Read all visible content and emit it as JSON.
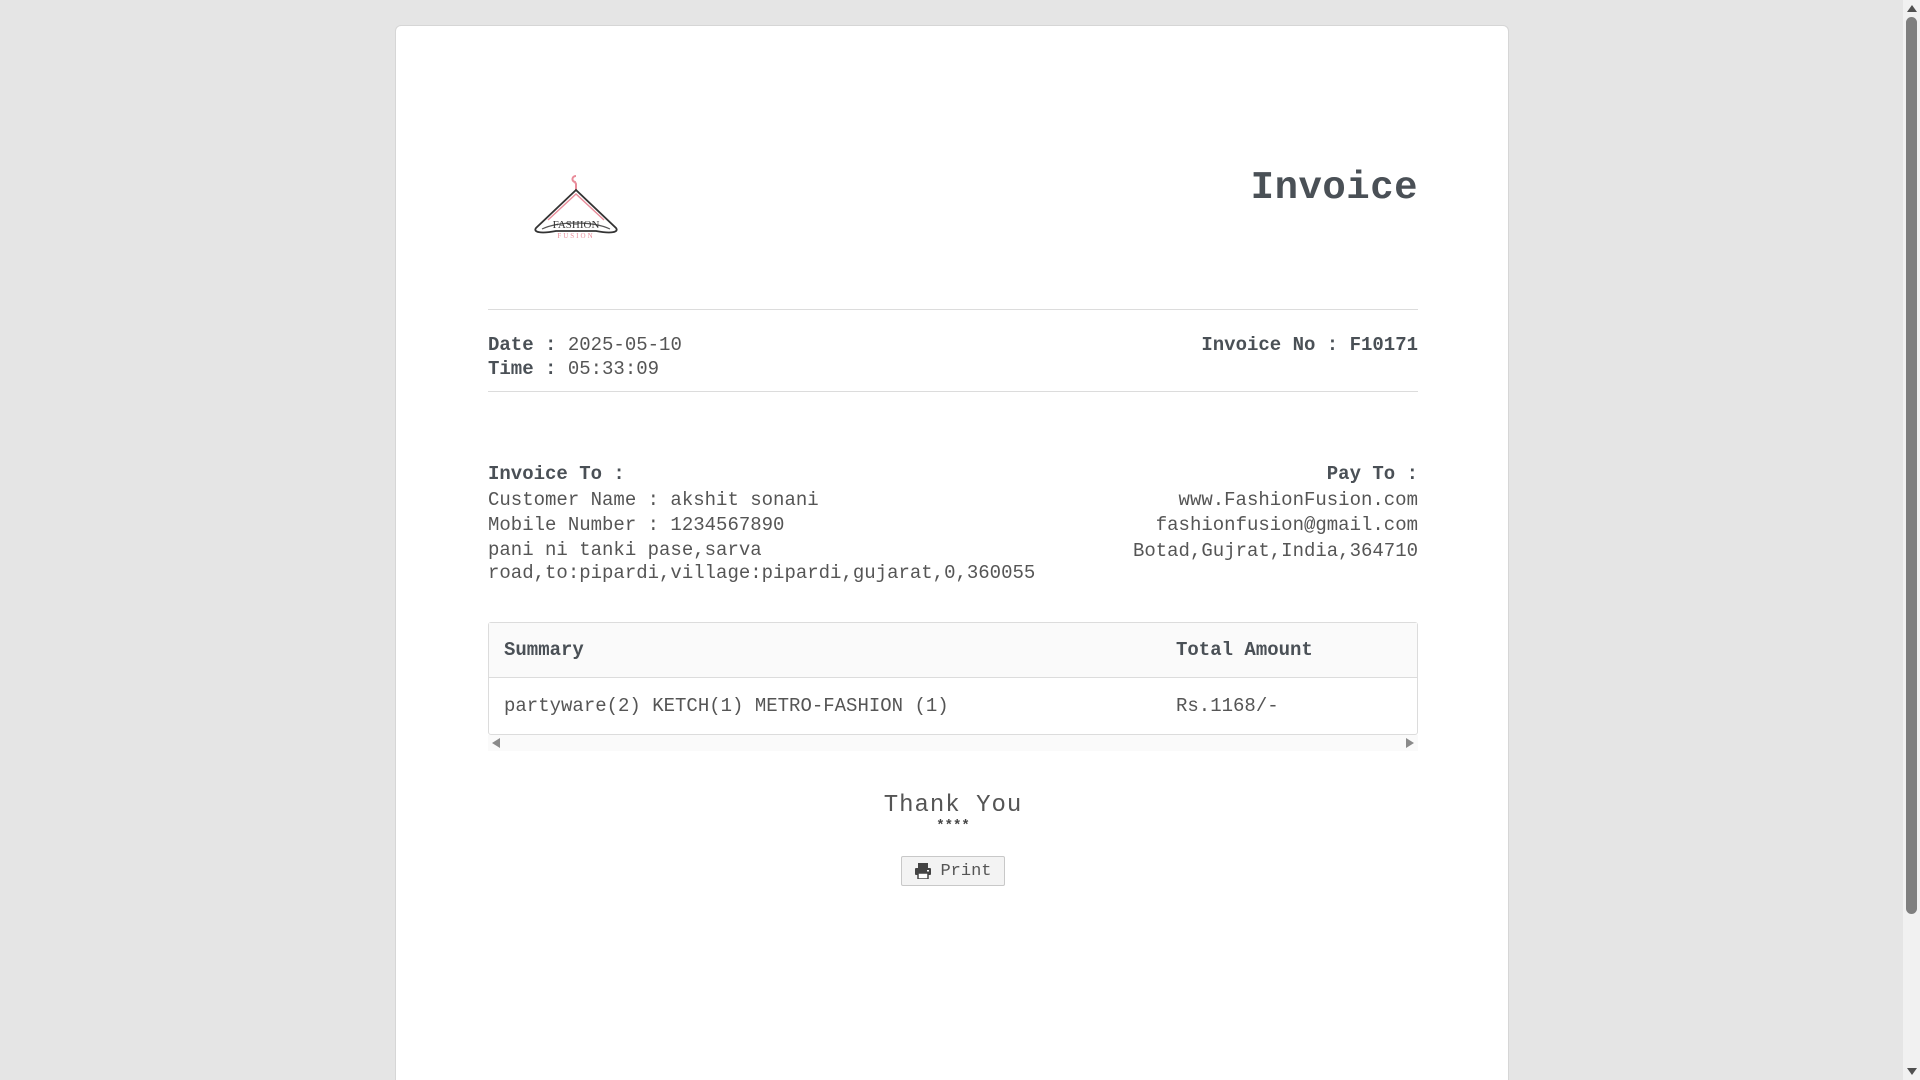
{
  "header": {
    "logo_name": "hanger-logo",
    "logo_text_top": "FASHION",
    "logo_text_bottom": "FUSION",
    "title": "Invoice"
  },
  "meta": {
    "date_label": "Date :",
    "date_value": "2025-05-10",
    "time_label": "Time :",
    "time_value": "05:33:09",
    "invoice_no": "Invoice No : F10171"
  },
  "bill_to": {
    "title": "Invoice To :",
    "customer_line": "Customer Name : akshit sonani",
    "mobile_line": "Mobile Number : 1234567890",
    "address": "pani ni tanki pase,sarva road,to:pipardi,village:pipardi,gujarat,0,360055"
  },
  "pay_to": {
    "title": "Pay To :",
    "website": "www.FashionFusion.com",
    "email": "fashionfusion@gmail.com",
    "address": "Botad,Gujrat,India,364710"
  },
  "table": {
    "columns": [
      "Summary",
      "Total Amount"
    ],
    "rows": [
      {
        "summary": "partyware(2) KETCH(1) METRO-FASHION (1)",
        "total": "Rs.1168/-"
      }
    ]
  },
  "footer": {
    "thanks": "Thank You",
    "stars": "****",
    "print_label": "Print"
  },
  "colors": {
    "page_background": "#e5e5e5",
    "sheet_background": "#ffffff",
    "logo_pink": "#e98c9a",
    "text": "#555555",
    "heading": "#4a5056"
  },
  "icons": {
    "print": "printer-icon",
    "scroll_left": "arrow-left-icon",
    "scroll_right": "arrow-right-icon",
    "scroll_up": "arrow-up-icon",
    "scroll_down": "arrow-down-icon"
  }
}
